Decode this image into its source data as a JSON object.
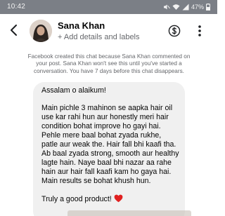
{
  "status_bar": {
    "time": "10:42",
    "battery": "47%"
  },
  "header": {
    "contact_name": "Sana Khan",
    "subtitle": "+ Add details and labels",
    "back_icon": "arrow-left-icon",
    "payment_icon": "dollar-circle-icon",
    "menu_icon": "vertical-dots-icon"
  },
  "system_note": "Facebook created this chat because Sana Khan commented on your post. Sana Khan won't see this until you've started a conversation. You have 7 days before this chat disappears.",
  "message": {
    "greeting": "Assalam o alaikum!",
    "body": "Main pichle 3 mahinon se aapka hair oil use kar rahi hun aur honestly meri hair condition bohat improve ho gayi hai. Pehle mere baal bohat zyada rukhe, patle aur weak the. Hair fall bhi kaafi tha. Ab baal zyada strong, smooth aur healthy lagte hain. Naye baal bhi nazar aa rahe hain aur hair fall kaafi kam ho gaya hai. Main results se bohat khush hun.",
    "closing": "Truly a good product!",
    "emoji_icon": "red-heart-icon"
  },
  "colors": {
    "status_bar": "#7b7f86",
    "bubble": "#f0f0f0",
    "secondary_text": "#65676b",
    "heart": "#e02020"
  }
}
